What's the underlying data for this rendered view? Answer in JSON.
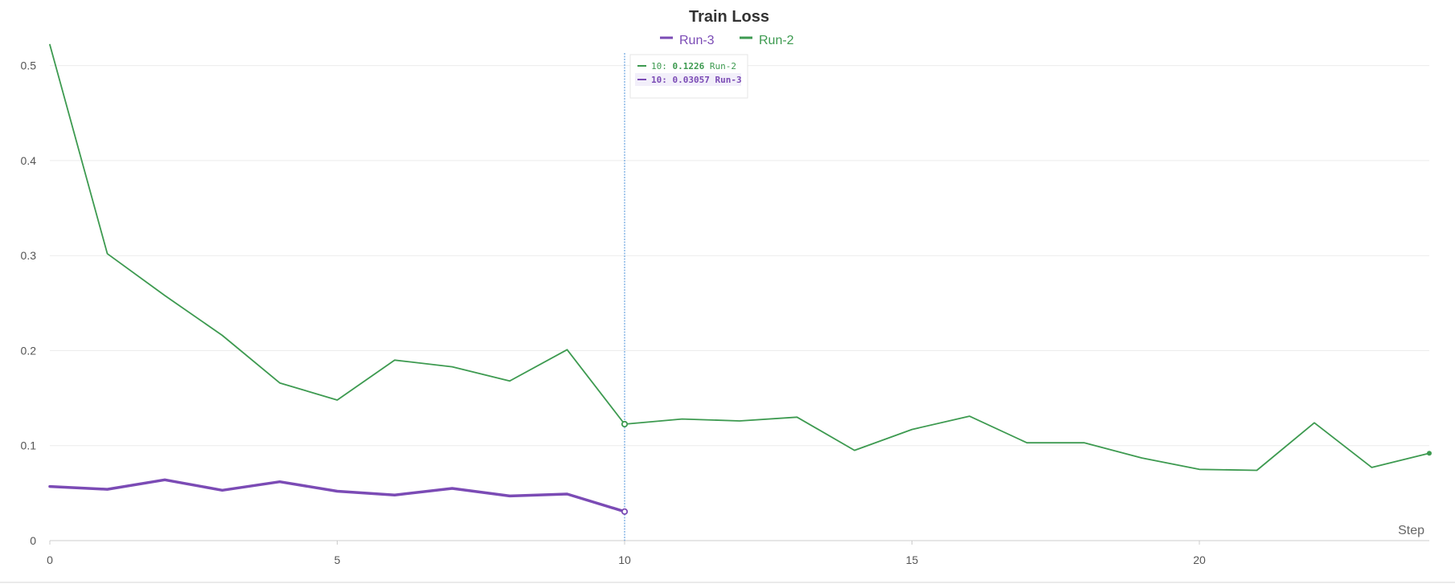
{
  "chart_data": {
    "type": "line",
    "title": "Train Loss",
    "xlabel": "Step",
    "ylabel": "",
    "xlim": [
      0,
      24
    ],
    "ylim": [
      0,
      0.52
    ],
    "xticks": [
      0,
      5,
      10,
      15,
      20
    ],
    "yticks": [
      0,
      0.1,
      0.2,
      0.3,
      0.4,
      0.5
    ],
    "xtick_labels": [
      "0",
      "5",
      "10",
      "15",
      "20"
    ],
    "ytick_labels": [
      "0",
      "0.1",
      "0.2",
      "0.3",
      "0.4",
      "0.5"
    ],
    "grid": true,
    "legend_position": "top-center",
    "series": [
      {
        "name": "Run-3",
        "color": "#7b4bb5",
        "x": [
          0,
          1,
          2,
          3,
          4,
          5,
          6,
          7,
          8,
          9,
          10
        ],
        "values": [
          0.057,
          0.054,
          0.064,
          0.053,
          0.062,
          0.052,
          0.048,
          0.055,
          0.047,
          0.049,
          0.03057
        ]
      },
      {
        "name": "Run-2",
        "color": "#3d9a50",
        "x": [
          0,
          1,
          2,
          3,
          4,
          5,
          6,
          7,
          8,
          9,
          10,
          11,
          12,
          13,
          14,
          15,
          16,
          17,
          18,
          19,
          20,
          21,
          22,
          23,
          24
        ],
        "values": [
          0.522,
          0.302,
          0.258,
          0.216,
          0.166,
          0.148,
          0.19,
          0.183,
          0.168,
          0.201,
          0.1226,
          0.128,
          0.126,
          0.13,
          0.095,
          0.117,
          0.131,
          0.103,
          0.103,
          0.087,
          0.075,
          0.074,
          0.124,
          0.077,
          0.092
        ]
      }
    ],
    "hover": {
      "x": 10,
      "entries": [
        {
          "step_label": "10:",
          "value_label": "0.1226",
          "series_label": "Run-2",
          "color": "#3d9a50",
          "highlight": false
        },
        {
          "step_label": "10:",
          "value_label": "0.03057",
          "series_label": "Run-3",
          "color": "#7b4bb5",
          "highlight": true
        }
      ]
    }
  }
}
